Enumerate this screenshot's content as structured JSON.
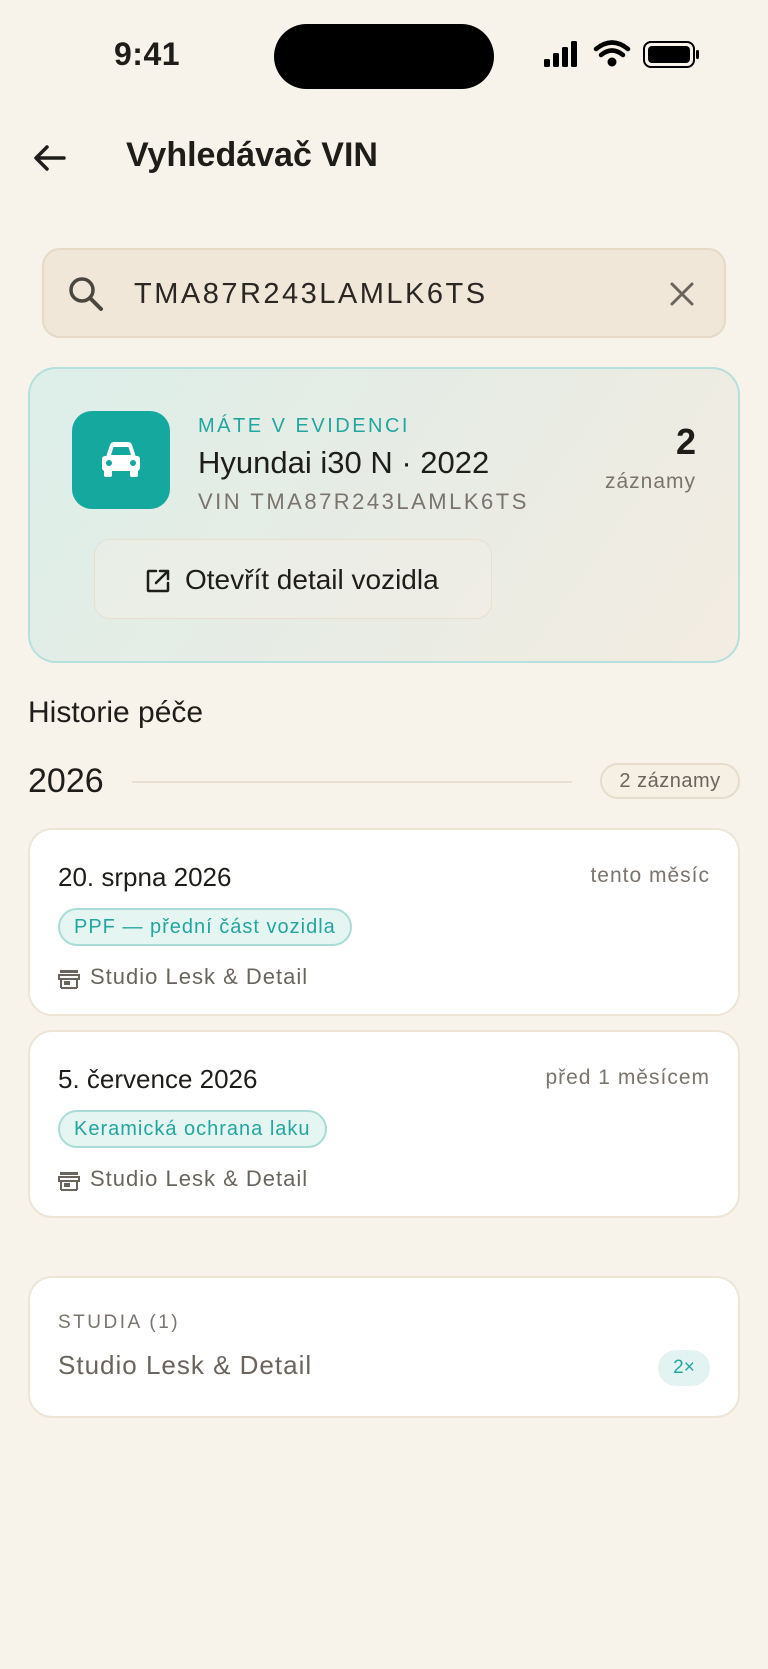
{
  "status_bar": {
    "time": "9:41"
  },
  "header": {
    "title": "Vyhledávač VIN"
  },
  "search": {
    "value": "TMA87R243LAMLK6TS",
    "placeholder": ""
  },
  "vehicle": {
    "kicker": "MÁTE V EVIDENCI",
    "name": "Hyundai i30 N · 2022",
    "vin": "VIN TMA87R243LAMLK6TS",
    "count": "2",
    "count_label": "záznamy",
    "open_label": "Otevřít detail vozidla"
  },
  "history": {
    "title": "Historie péče",
    "year": "2026",
    "year_badge": "2 záznamy",
    "records": [
      {
        "date": "20. srpna 2026",
        "relative": "tento měsíc",
        "tag": "PPF — přední část vozidla",
        "studio": "Studio Lesk & Detail"
      },
      {
        "date": "5. července 2026",
        "relative": "před 1 měsícem",
        "tag": "Keramická ochrana laku",
        "studio": "Studio Lesk & Detail"
      }
    ]
  },
  "studia": {
    "heading": "STUDIA (1)",
    "items": [
      {
        "name": "Studio Lesk & Detail",
        "count": "2×"
      }
    ]
  },
  "colors": {
    "accent": "#14a89f",
    "background": "#f7f2ea",
    "search_bg": "#f0e7d8"
  },
  "icons": [
    "signal-icon",
    "wifi-icon",
    "battery-icon",
    "back-arrow-icon",
    "search-icon",
    "close-icon",
    "car-icon",
    "open-external-icon",
    "store-icon"
  ]
}
